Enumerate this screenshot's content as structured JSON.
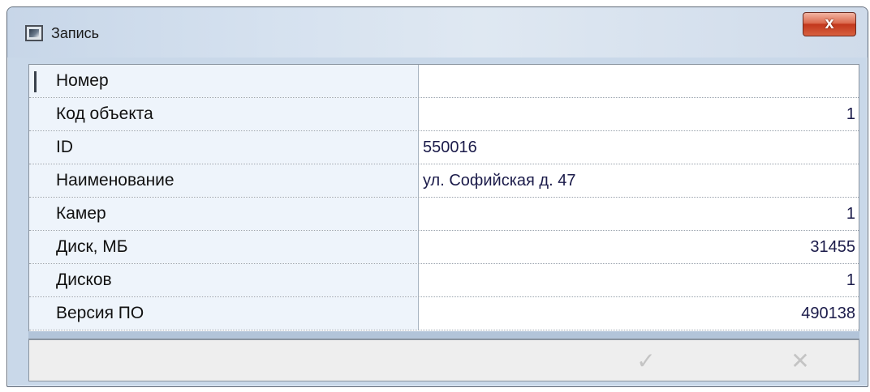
{
  "window": {
    "title": "Запись",
    "close_label": "x"
  },
  "rows": [
    {
      "label": "Номер",
      "value": "",
      "align": "left"
    },
    {
      "label": "Код объекта",
      "value": "1",
      "align": "right"
    },
    {
      "label": "ID",
      "value": "550016",
      "align": "left"
    },
    {
      "label": "Наименование",
      "value": "ул. Софийская д. 47",
      "align": "left"
    },
    {
      "label": "Камер",
      "value": "1",
      "align": "right"
    },
    {
      "label": "Диск, МБ",
      "value": "31455",
      "align": "right"
    },
    {
      "label": "Дисков",
      "value": "1",
      "align": "right"
    },
    {
      "label": "Версия ПО",
      "value": "490138",
      "align": "right"
    }
  ],
  "footer": {
    "confirm_icon": "✓",
    "cancel_icon": "✕"
  },
  "colors": {
    "label_background": "#eef4fb",
    "close_button": "#c2371c",
    "disabled_icon": "#c4c4c4"
  }
}
